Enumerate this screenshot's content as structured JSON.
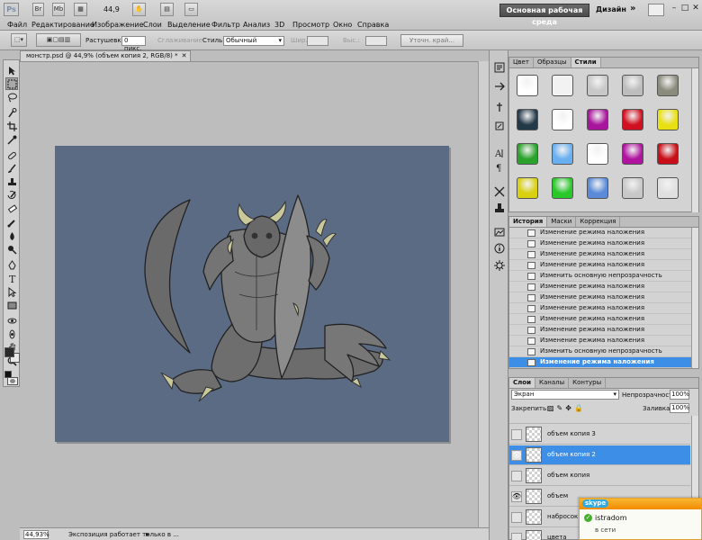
{
  "app": {
    "logo": "Ps",
    "zoom": "44,9"
  },
  "menu": [
    "Файл",
    "Редактирование",
    "Изображение",
    "Слои",
    "Выделение",
    "Фильтр",
    "Анализ",
    "3D",
    "Просмотр",
    "Окно",
    "Справка"
  ],
  "workspace": {
    "active": "Основная рабочая среда",
    "design": "Дизайн",
    "more": "»"
  },
  "options": {
    "feather_label": "Растушевка:",
    "feather_value": "0 пикс.",
    "antialias_label": "Сглаживание",
    "style_label": "Стиль:",
    "style_value": "Обычный",
    "width_label": "Шир.:",
    "height_label": "Выс.:",
    "refine_button": "Уточн. край..."
  },
  "document": {
    "tab_title": "монстр.psd @ 44,9% (объем копия 2, RGB/8) *",
    "status_zoom": "44,93%",
    "status_info": "Экспозиция работает только в ..."
  },
  "styles_panel": {
    "tabs": [
      "Цвет",
      "Образцы",
      "Стили"
    ],
    "active_tab": "Стили",
    "swatch_colors": [
      [
        "#ffffff",
        "#f2f2f2",
        "#c8c8c8",
        "#bdbdbd",
        "#8b8b7d"
      ],
      [
        "#233848",
        "#ffffff",
        "#a8149c",
        "#d01020",
        "#e8e010"
      ],
      [
        "#2ba22b",
        "#6ab0f0",
        "#ffffff",
        "#b0149f",
        "#c80e18"
      ],
      [
        "#d8d010",
        "#28c828",
        "#5a8ad8",
        "#c8c8c8",
        "#e0e0e0"
      ]
    ]
  },
  "history_panel": {
    "tabs": [
      "История",
      "Маски",
      "Коррекция"
    ],
    "active_tab": "История",
    "items": [
      "Изменение режима наложения",
      "Изменение режима наложения",
      "Изменение режима наложения",
      "Изменение режима наложения",
      "Изменить основную непрозрачность",
      "Изменение режима наложения",
      "Изменение режима наложения",
      "Изменение режима наложения",
      "Изменение режима наложения",
      "Изменение режима наложения",
      "Изменение режима наложения",
      "Изменить основную непрозрачность",
      "Изменение режима наложения"
    ],
    "selected_index": 12
  },
  "layers_panel": {
    "tabs": [
      "Слои",
      "Каналы",
      "Контуры"
    ],
    "active_tab": "Слои",
    "blend_mode": "Экран",
    "opacity_label": "Непрозрачность:",
    "opacity_value": "100%",
    "lock_label": "Закрепить:",
    "fill_label": "Заливка:",
    "fill_value": "100%",
    "layers": [
      {
        "name": "объем копия 3",
        "visible": false
      },
      {
        "name": "объем копия 2",
        "visible": true,
        "selected": true
      },
      {
        "name": "объем копия",
        "visible": false
      },
      {
        "name": "объем",
        "visible": true
      },
      {
        "name": "набросок",
        "visible": false
      },
      {
        "name": "цвета",
        "visible": false
      }
    ]
  },
  "skype": {
    "brand": "skype",
    "user": "istradom",
    "status": "в сети"
  }
}
